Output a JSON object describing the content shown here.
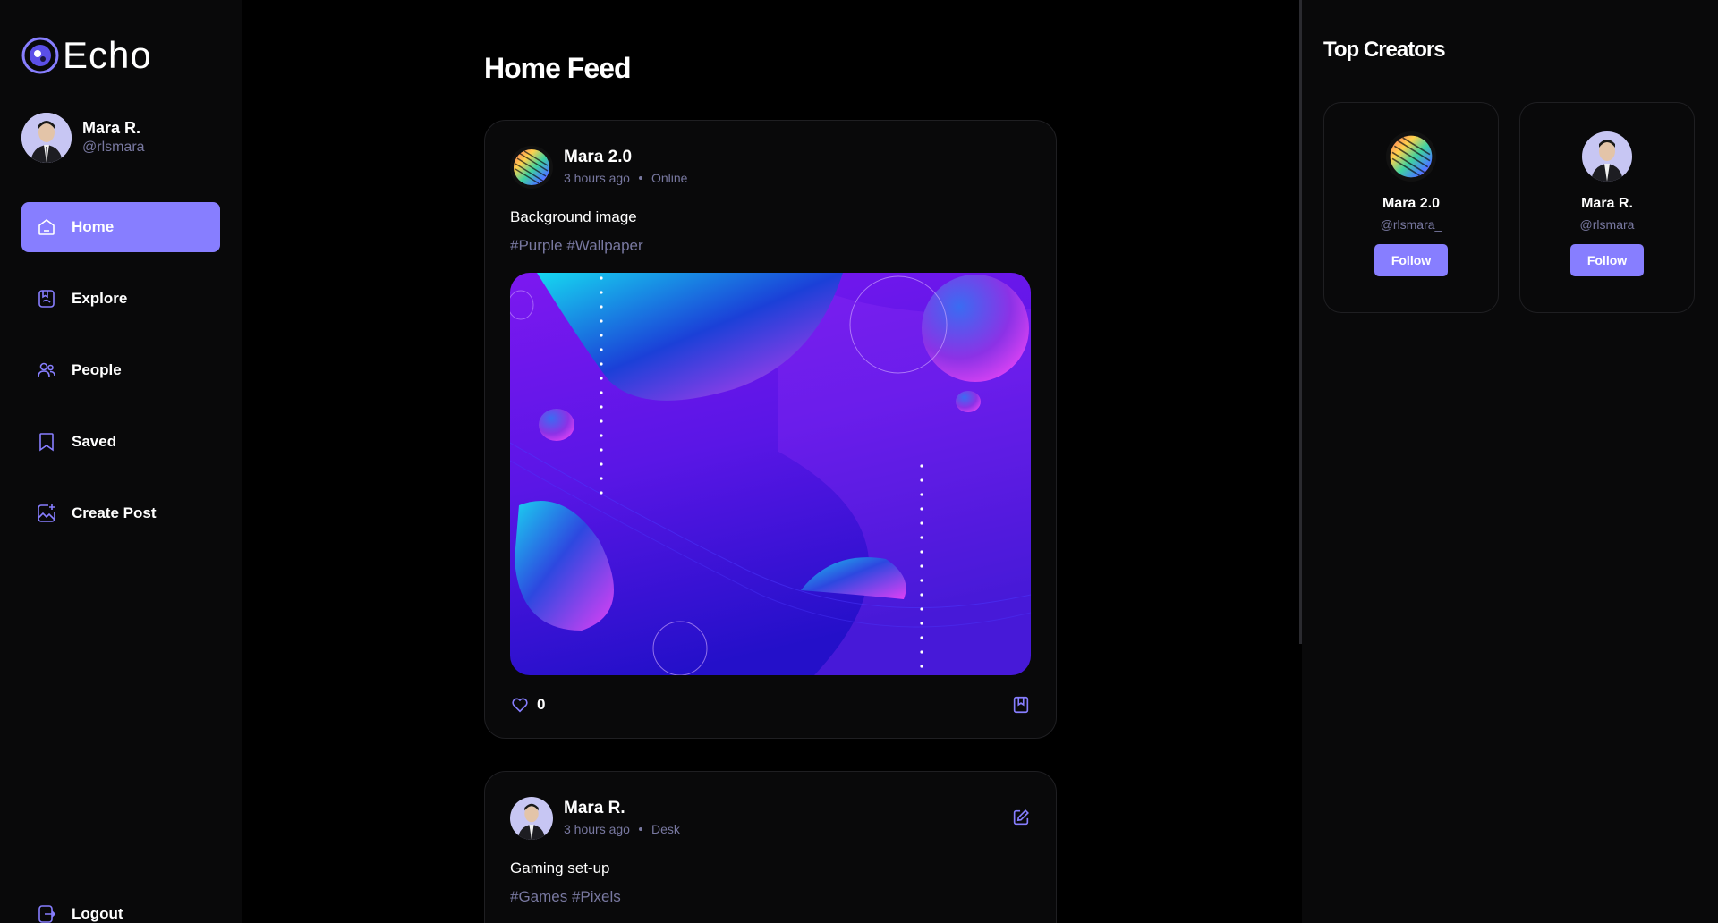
{
  "app": {
    "name": "Echo",
    "accent": "#877eff",
    "muted": "#7878a0"
  },
  "user": {
    "name": "Mara R.",
    "handle": "@rlsmara"
  },
  "nav": {
    "items": [
      {
        "label": "Home",
        "icon": "home-icon",
        "active": true
      },
      {
        "label": "Explore",
        "icon": "explore-icon",
        "active": false
      },
      {
        "label": "People",
        "icon": "people-icon",
        "active": false
      },
      {
        "label": "Saved",
        "icon": "bookmark-icon",
        "active": false
      },
      {
        "label": "Create Post",
        "icon": "image-add-icon",
        "active": false
      }
    ],
    "logout_label": "Logout"
  },
  "feed": {
    "title": "Home Feed",
    "posts": [
      {
        "author": "Mara 2.0",
        "time": "3 hours ago",
        "location": "Online",
        "caption": "Background image",
        "tags": "#Purple #Wallpaper",
        "likes": "0"
      },
      {
        "author": "Mara R.",
        "time": "3 hours ago",
        "location": "Desk",
        "caption": "Gaming set-up",
        "tags": "#Games #Pixels"
      }
    ]
  },
  "top_creators": {
    "title": "Top Creators",
    "creators": [
      {
        "name": "Mara 2.0",
        "handle": "@rlsmara_",
        "button": "Follow"
      },
      {
        "name": "Mara R.",
        "handle": "@rlsmara",
        "button": "Follow"
      }
    ]
  }
}
